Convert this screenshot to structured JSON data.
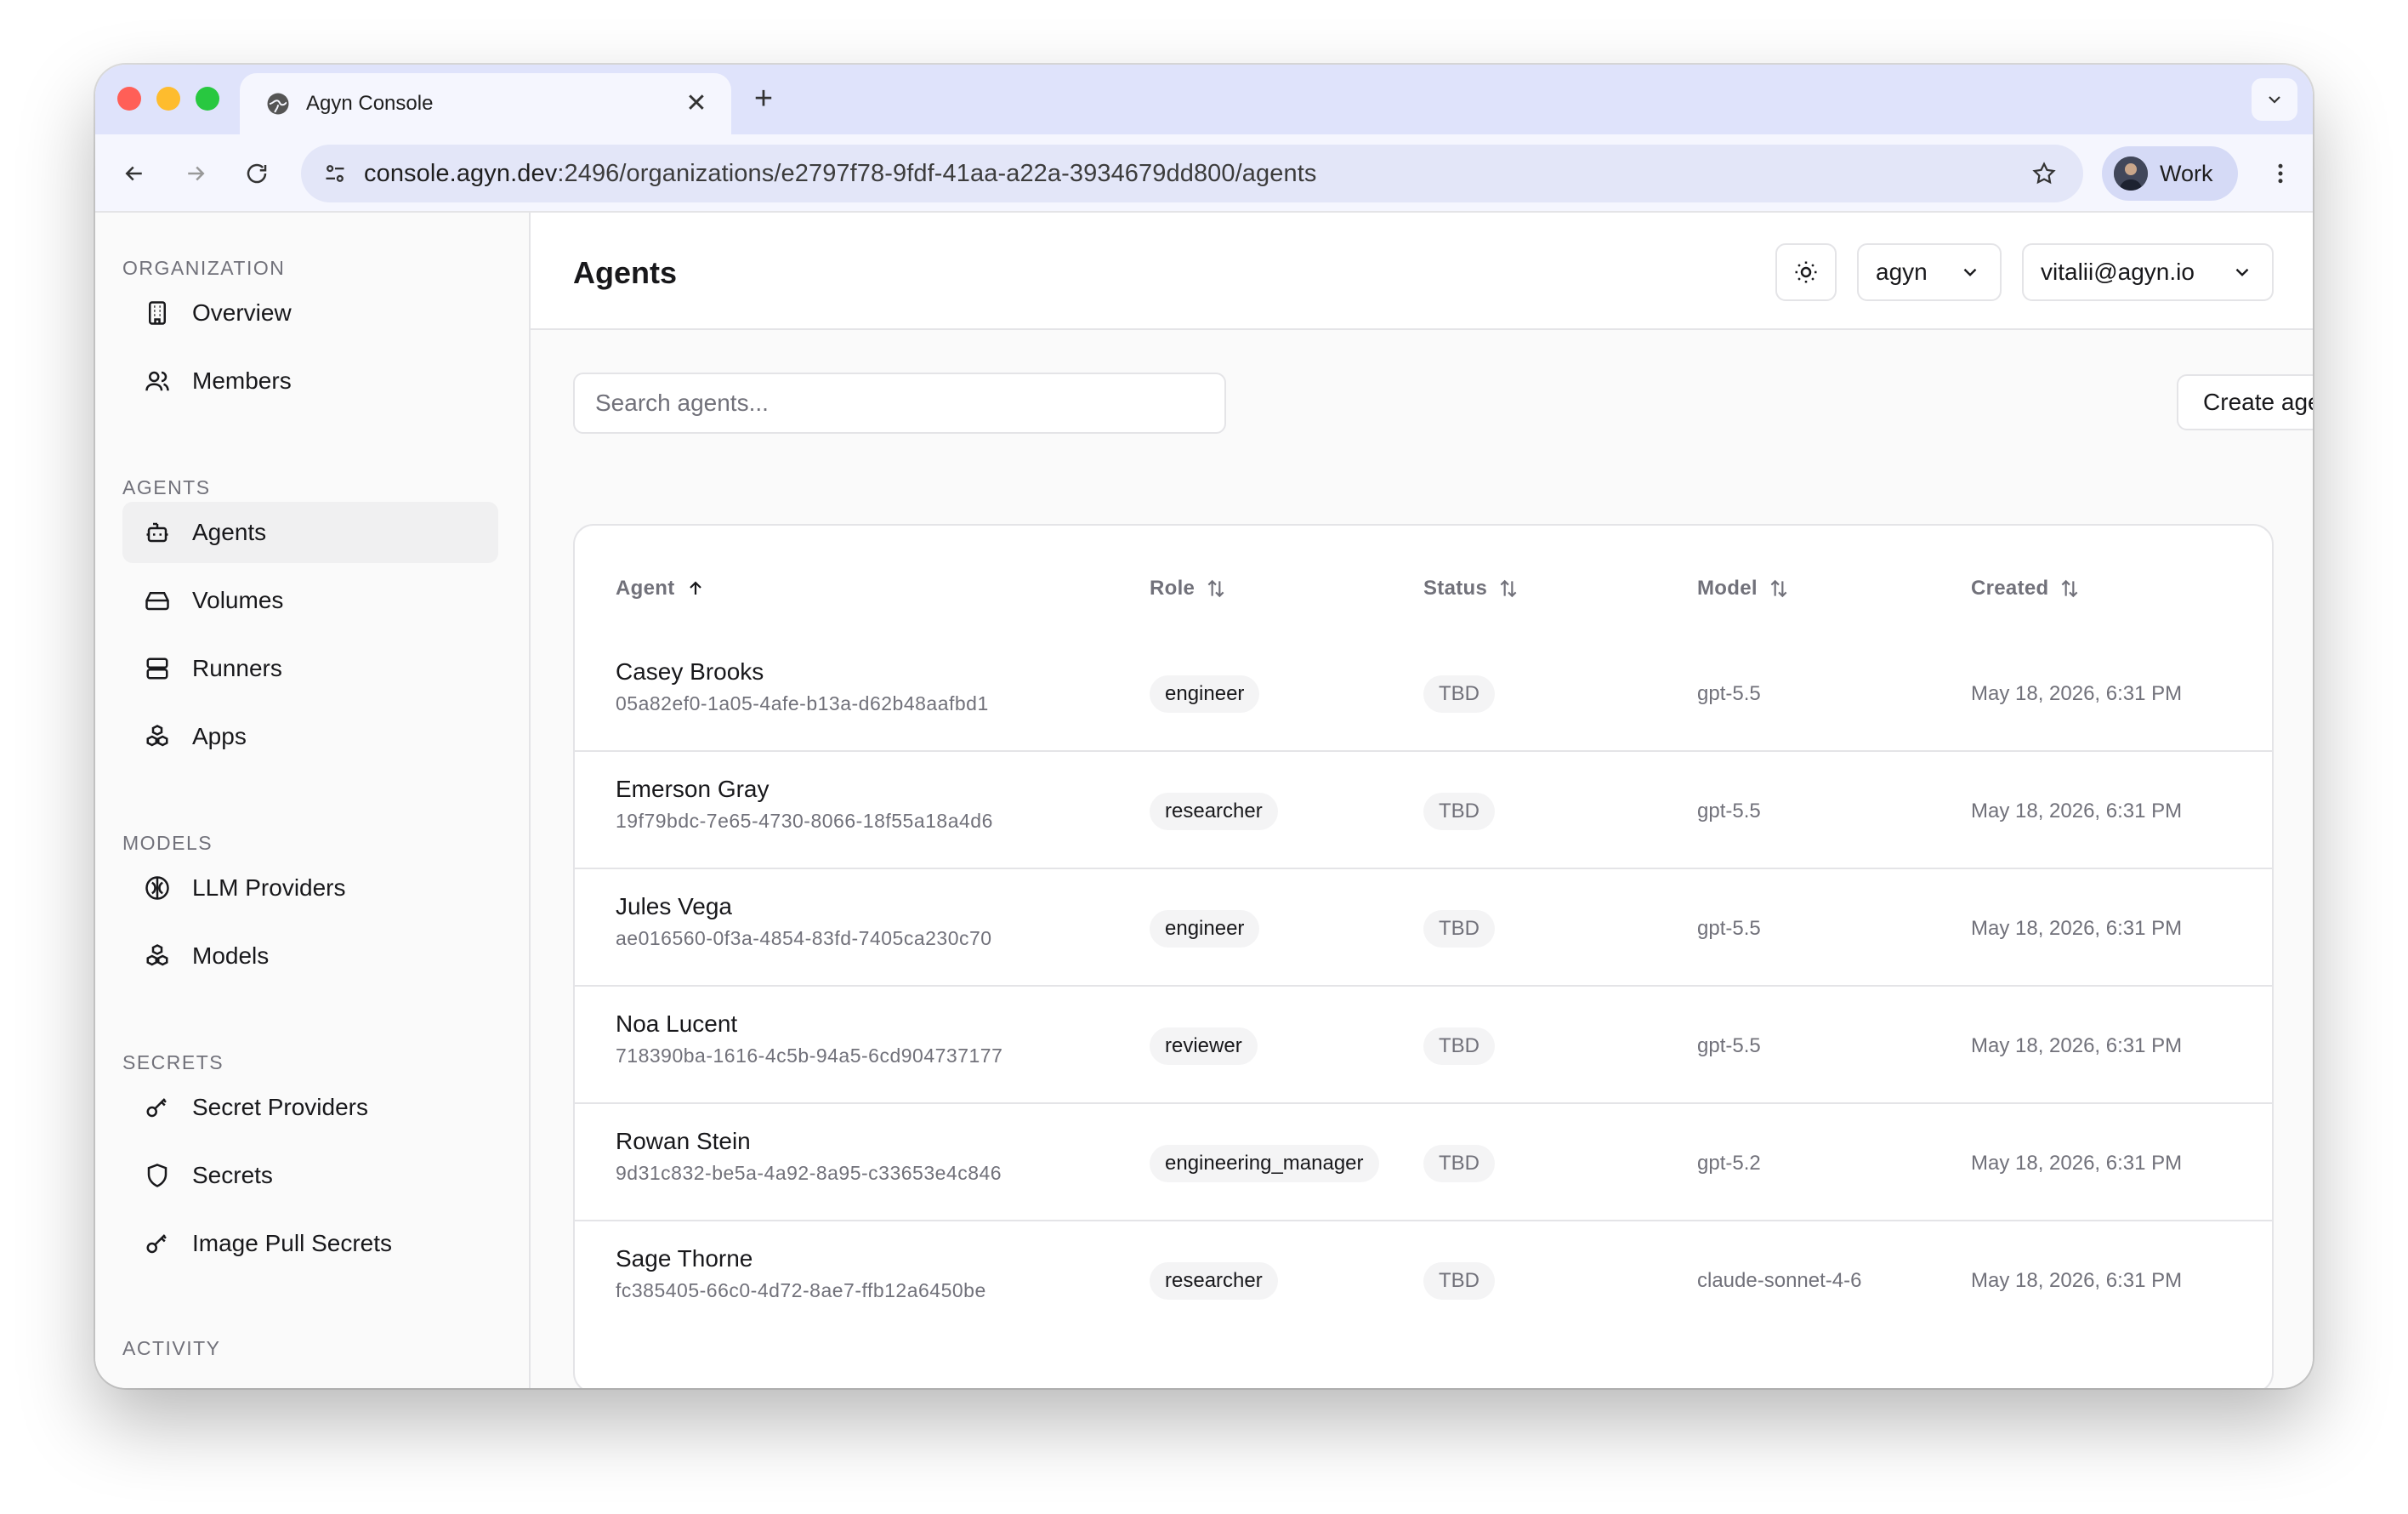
{
  "browser": {
    "tab_title": "Agyn Console",
    "url_host": "console.agyn.dev",
    "url_path": ":2496/organizations/e2797f78-9fdf-41aa-a22a-3934679dd800/agents",
    "profile_label": "Work"
  },
  "sidebar": {
    "sections": [
      {
        "title": "ORGANIZATION",
        "items": [
          {
            "label": "Overview",
            "icon": "building-icon"
          },
          {
            "label": "Members",
            "icon": "users-icon"
          }
        ]
      },
      {
        "title": "AGENTS",
        "items": [
          {
            "label": "Agents",
            "icon": "bot-icon",
            "active": true
          },
          {
            "label": "Volumes",
            "icon": "hard-drive-icon"
          },
          {
            "label": "Runners",
            "icon": "server-icon"
          },
          {
            "label": "Apps",
            "icon": "boxes-icon"
          }
        ]
      },
      {
        "title": "MODELS",
        "items": [
          {
            "label": "LLM Providers",
            "icon": "brain-icon"
          },
          {
            "label": "Models",
            "icon": "boxes-icon"
          }
        ]
      },
      {
        "title": "SECRETS",
        "items": [
          {
            "label": "Secret Providers",
            "icon": "key-icon"
          },
          {
            "label": "Secrets",
            "icon": "shield-icon"
          },
          {
            "label": "Image Pull Secrets",
            "icon": "key-icon"
          }
        ]
      },
      {
        "title": "ACTIVITY",
        "items": []
      }
    ]
  },
  "header": {
    "title": "Agents",
    "org_select": "agyn",
    "user_select": "vitalii@agyn.io"
  },
  "toolbar": {
    "search_placeholder": "Search agents...",
    "create_label": "Create agent"
  },
  "table": {
    "columns": [
      "Agent",
      "Role",
      "Status",
      "Model",
      "Created"
    ],
    "sort": {
      "column": "Agent",
      "direction": "asc"
    },
    "rows": [
      {
        "name": "Casey Brooks",
        "id": "05a82ef0-1a05-4afe-b13a-d62b48aafbd1",
        "role": "engineer",
        "status": "TBD",
        "model": "gpt-5.5",
        "created": "May 18, 2026, 6:31 PM"
      },
      {
        "name": "Emerson Gray",
        "id": "19f79bdc-7e65-4730-8066-18f55a18a4d6",
        "role": "researcher",
        "status": "TBD",
        "model": "gpt-5.5",
        "created": "May 18, 2026, 6:31 PM"
      },
      {
        "name": "Jules Vega",
        "id": "ae016560-0f3a-4854-83fd-7405ca230c70",
        "role": "engineer",
        "status": "TBD",
        "model": "gpt-5.5",
        "created": "May 18, 2026, 6:31 PM"
      },
      {
        "name": "Noa Lucent",
        "id": "718390ba-1616-4c5b-94a5-6cd904737177",
        "role": "reviewer",
        "status": "TBD",
        "model": "gpt-5.5",
        "created": "May 18, 2026, 6:31 PM"
      },
      {
        "name": "Rowan Stein",
        "id": "9d31c832-be5a-4a92-8a95-c33653e4c846",
        "role": "engineering_manager",
        "status": "TBD",
        "model": "gpt-5.2",
        "created": "May 18, 2026, 6:31 PM"
      },
      {
        "name": "Sage Thorne",
        "id": "fc385405-66c0-4d72-8ae7-ffb12a6450be",
        "role": "researcher",
        "status": "TBD",
        "model": "claude-sonnet-4-6",
        "created": "May 18, 2026, 6:31 PM"
      }
    ]
  }
}
